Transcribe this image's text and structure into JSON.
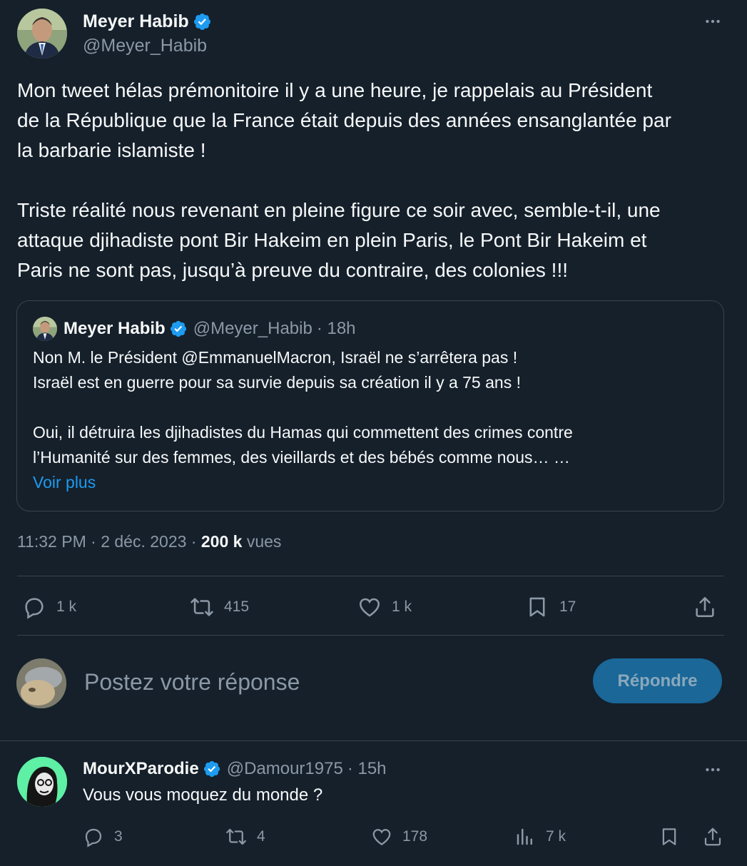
{
  "main_tweet": {
    "author": {
      "display_name": "Meyer Habib",
      "handle": "@Meyer_Habib",
      "verified": true
    },
    "text_paragraphs": [
      [
        "Mon tweet hélas prémonitoire il y a une heure, je rappelais au Président",
        "de la République que la France était depuis des années ensanglantée par",
        "la barbarie islamiste !"
      ],
      [
        "Triste réalité nous revenant en pleine figure ce soir avec, semble-t-il, une",
        "attaque djihadiste pont Bir Hakeim en plein Paris, le Pont Bir Hakeim et",
        "Paris ne sont pas, jusqu’à preuve du contraire, des colonies !!!"
      ]
    ],
    "quoted_tweet": {
      "display_name": "Meyer Habib",
      "handle": "@Meyer_Habib",
      "time": "· 18h",
      "lines_1": [
        "Non M. le Président @EmmanuelMacron, Israël ne s’arrêtera pas !",
        "Israël est en guerre pour sa survie depuis sa création il y a 75 ans !"
      ],
      "lines_2": [
        "Oui, il détruira les djihadistes du Hamas qui commettent des crimes contre",
        "l’Humanité sur des femmes, des vieillards et des bébés comme nous… …"
      ],
      "show_more": "Voir plus"
    },
    "meta": {
      "time": "11:32 PM",
      "sep1": " · ",
      "date": "2 déc. 2023",
      "sep2": " · ",
      "views": "200 k",
      "views_label": " vues"
    },
    "actions": {
      "replies": "1 k",
      "retweets": "415",
      "likes": "1 k",
      "bookmarks": "17"
    }
  },
  "composer": {
    "placeholder": "Postez votre réponse",
    "button": "Répondre"
  },
  "reply": {
    "display_name": "MourXParodie",
    "handle": "@Damour1975",
    "time": "· 15h",
    "text": "Vous vous moquez du monde ?",
    "actions": {
      "replies": "3",
      "retweets": "4",
      "likes": "178",
      "views": "7 k"
    }
  },
  "colors": {
    "background": "#15202b",
    "accent": "#1d9bf0",
    "muted": "#8b98a5",
    "border": "#38444d"
  }
}
